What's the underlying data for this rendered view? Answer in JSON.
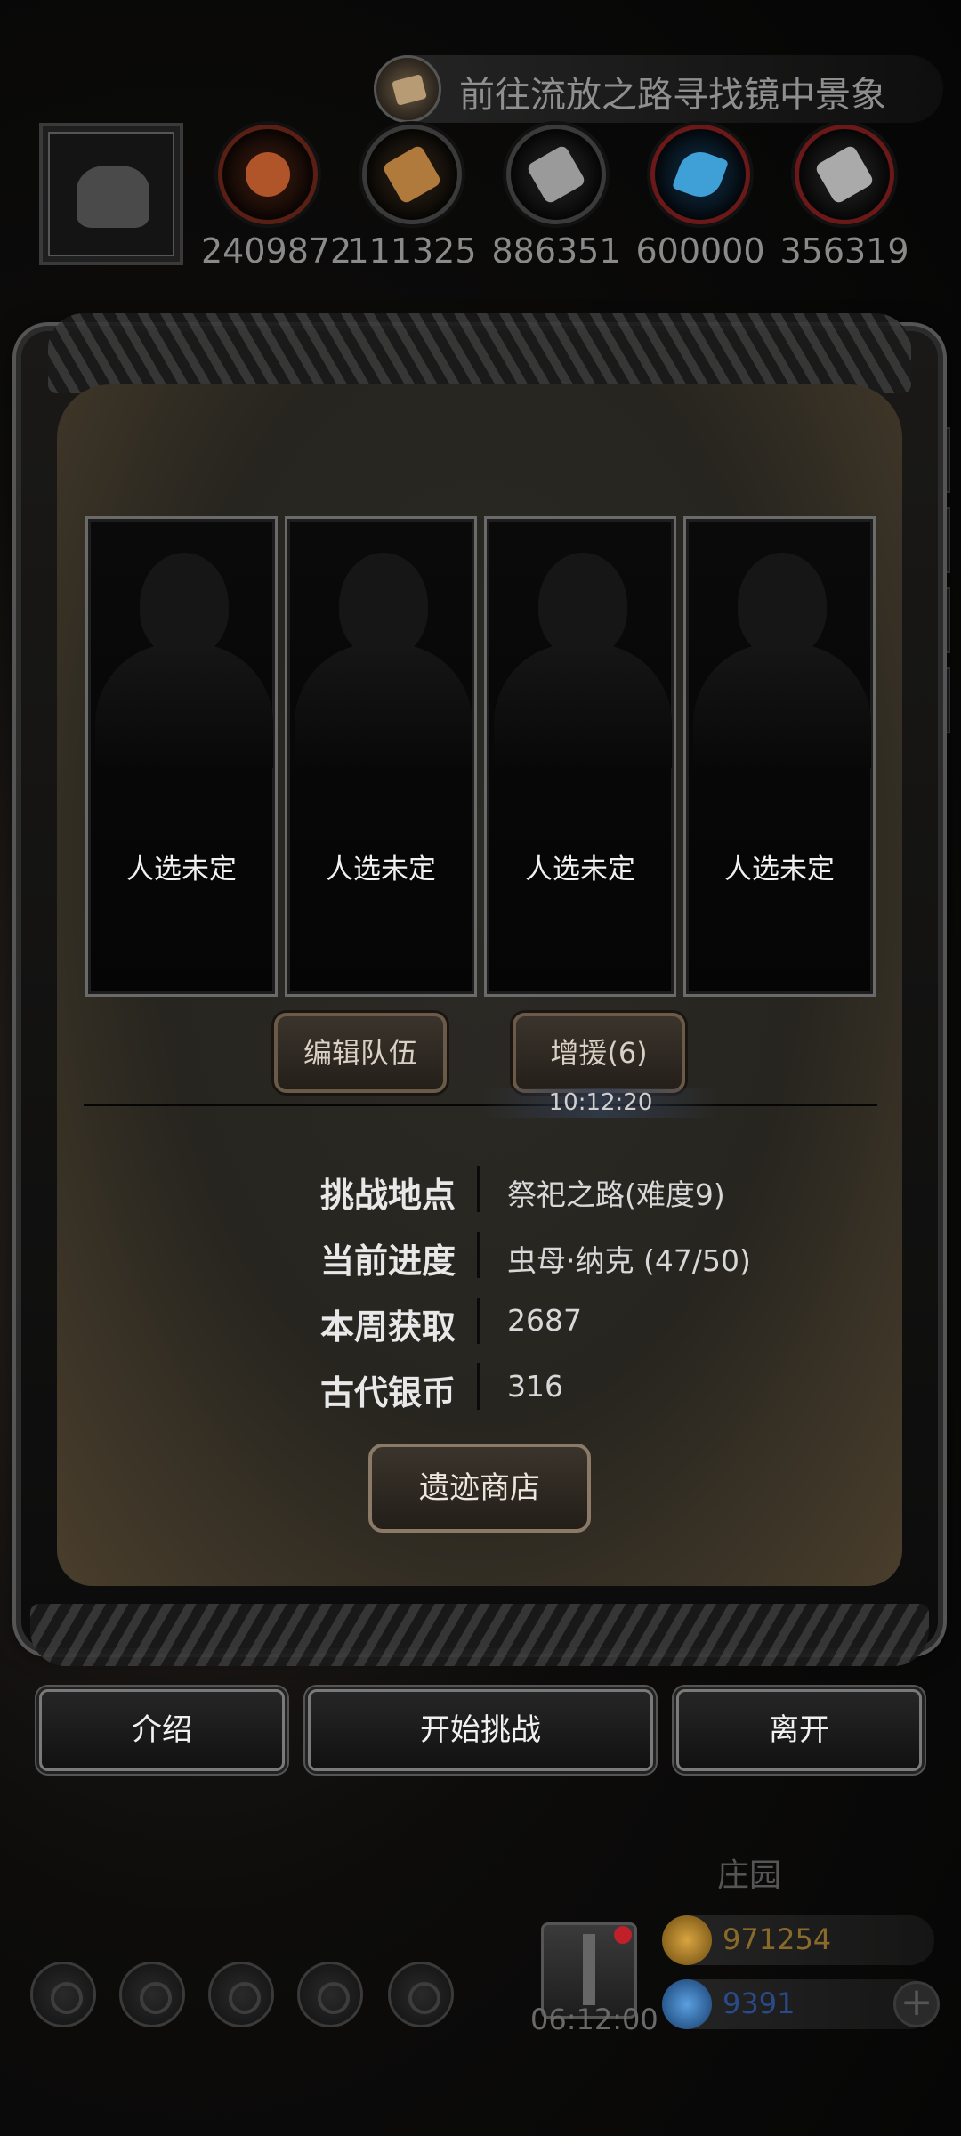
{
  "quest": {
    "text": "前往流放之路寻找镜中景象",
    "icon": "scroll-icon"
  },
  "resources": [
    {
      "icon": "meat-icon",
      "value": "2409872"
    },
    {
      "icon": "wood-planks-icon",
      "value": "111325"
    },
    {
      "icon": "stone-blocks-icon",
      "value": "886351"
    },
    {
      "icon": "crystal-icon",
      "value": "600000"
    },
    {
      "icon": "iron-ingot-icon",
      "value": "356319"
    }
  ],
  "team": {
    "slots": [
      {
        "label": "人选未定"
      },
      {
        "label": "人选未定"
      },
      {
        "label": "人选未定"
      },
      {
        "label": "人选未定"
      }
    ],
    "edit_button": "编辑队伍",
    "reinforce_button": "增援(6)",
    "timer": "10:12:20"
  },
  "info": [
    {
      "key": "挑战地点",
      "value": "祭祀之路(难度9)"
    },
    {
      "key": "当前进度",
      "value": "虫母·纳克 (47/50)"
    },
    {
      "key": "本周获取",
      "value": "2687"
    },
    {
      "key": "古代银币",
      "value": "316"
    }
  ],
  "shop_button": "遗迹商店",
  "actions": {
    "intro": "介绍",
    "start": "开始挑战",
    "leave": "离开"
  },
  "background": {
    "estate_label": "庄园",
    "gift_timer": "06:12:00",
    "gold": "971254",
    "gems": "9391"
  },
  "colors": {
    "panel_border": "#6a5a48",
    "gold_text": "#8a6a2a",
    "gem_text": "#2a4a8a",
    "alert": "#c0202a"
  }
}
